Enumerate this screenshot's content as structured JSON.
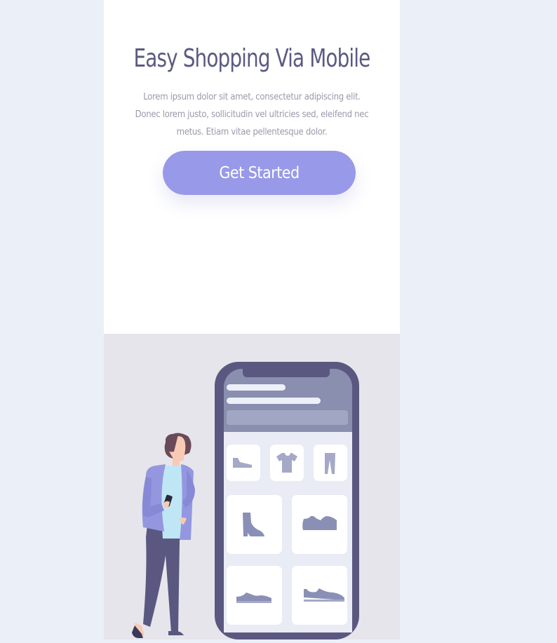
{
  "hero": {
    "title": "Easy Shopping Via Mobile",
    "description": "Lorem ipsum dolor sit amet, consectetur adipiscing elit. Donec lorem justo, sollicitudin vel ultricies sed, eleifend nec metus. Etiam vitae pellentesque dolor.",
    "cta_label": "Get Started"
  },
  "illustration": {
    "products": [
      "sneaker-icon",
      "tshirt-icon",
      "pants-icon",
      "boot-icon",
      "sneaker-icon",
      "sneaker-icon",
      "sneaker-icon"
    ]
  },
  "colors": {
    "page_background": "#ebeff8",
    "card_background": "#ffffff",
    "title": "#5b5a82",
    "body_text": "#9a9aad",
    "accent": "#9899e8",
    "illustration_background": "#e6e5eb",
    "phone_frame": "#5a5880"
  }
}
